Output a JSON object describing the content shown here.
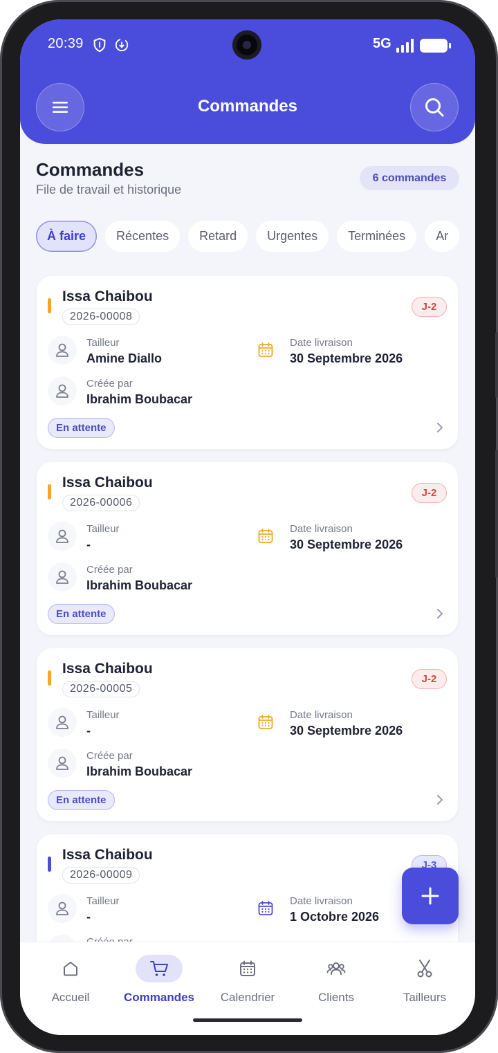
{
  "status_bar": {
    "time": "20:39",
    "network": "5G"
  },
  "header": {
    "title": "Commandes"
  },
  "page": {
    "title": "Commandes",
    "subtitle": "File de travail et historique",
    "count_badge": "6 commandes"
  },
  "filters": [
    {
      "label": "À faire",
      "active": true
    },
    {
      "label": "Récentes",
      "active": false
    },
    {
      "label": "Retard",
      "active": false
    },
    {
      "label": "Urgentes",
      "active": false
    },
    {
      "label": "Terminées",
      "active": false
    },
    {
      "label": "Ar",
      "active": false
    }
  ],
  "field_labels": {
    "tailor": "Tailleur",
    "delivery": "Date livraison",
    "created_by": "Créée par"
  },
  "orders": [
    {
      "client": "Issa Chaibou",
      "code": "2026-00008",
      "due": "J-2",
      "tailor": "Amine Diallo",
      "delivery_date": "30 Septembre 2026",
      "created_by": "Ibrahim Boubacar",
      "status": "En attente",
      "priority_color": "#f5a623"
    },
    {
      "client": "Issa Chaibou",
      "code": "2026-00006",
      "due": "J-2",
      "tailor": "-",
      "delivery_date": "30 Septembre 2026",
      "created_by": "Ibrahim Boubacar",
      "status": "En attente",
      "priority_color": "#f5a623"
    },
    {
      "client": "Issa Chaibou",
      "code": "2026-00005",
      "due": "J-2",
      "tailor": "-",
      "delivery_date": "30 Septembre 2026",
      "created_by": "Ibrahim Boubacar",
      "status": "En attente",
      "priority_color": "#f5a623"
    },
    {
      "client": "Issa Chaibou",
      "code": "2026-00009",
      "due": "J-3",
      "tailor": "-",
      "delivery_date": "1 Octobre 2026",
      "created_by": "Créée par",
      "priority_color": "#4a4cdc"
    }
  ],
  "bottom_nav": [
    {
      "label": "Accueil",
      "icon": "home-icon",
      "active": false
    },
    {
      "label": "Commandes",
      "icon": "cart-icon",
      "active": true
    },
    {
      "label": "Calendrier",
      "icon": "calendar-icon",
      "active": false
    },
    {
      "label": "Clients",
      "icon": "users-icon",
      "active": false
    },
    {
      "label": "Tailleurs",
      "icon": "scissors-icon",
      "active": false
    }
  ],
  "colors": {
    "primary": "#4a4cdc",
    "urgent": "#d64545",
    "calendar_orange": "#f5a623"
  }
}
